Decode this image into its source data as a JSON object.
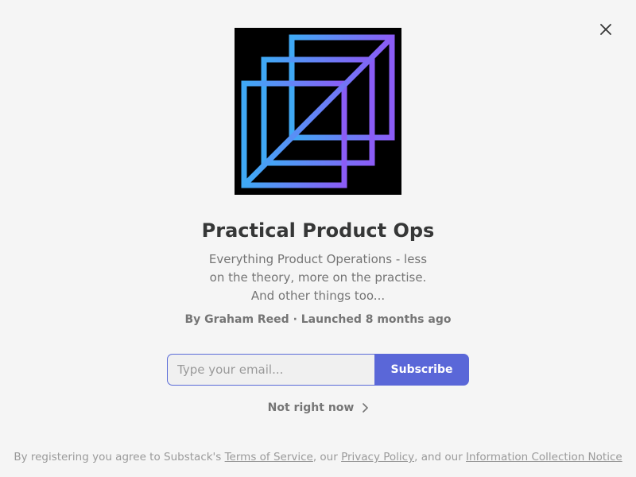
{
  "modal": {
    "close_icon": "close-icon",
    "title": "Practical Product Ops",
    "description": "Everything Product Operations - less on the theory, more on the practise. And other things too...",
    "byline": "By Graham Reed · Launched 8 months ago"
  },
  "subscribe": {
    "email_placeholder": "Type your email...",
    "email_value": "",
    "button_label": "Subscribe",
    "accent_color": "#5a67d8"
  },
  "dismiss": {
    "label": "Not right now",
    "icon": "chevron-right-icon"
  },
  "footer": {
    "prefix": "By registering you agree to Substack's ",
    "terms_link": "Terms of Service",
    "sep1": ", our ",
    "privacy_link": "Privacy Policy",
    "sep2": ", and our ",
    "notice_link": "Information Collection Notice"
  },
  "logo": {
    "gradient_start": "#3fa9f5",
    "gradient_end": "#8b5cf6",
    "background": "#000000"
  }
}
